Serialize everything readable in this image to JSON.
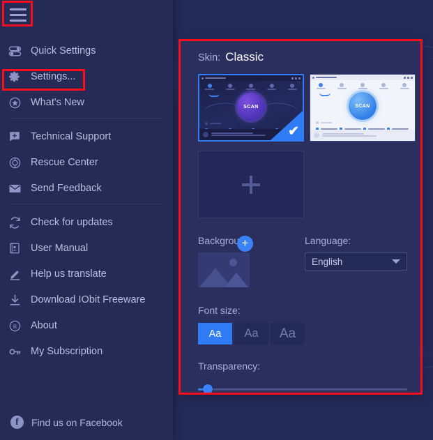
{
  "sidebar": {
    "hamburger_icon": "hamburger-menu-icon",
    "groups": [
      {
        "items": [
          {
            "label": "Quick Settings",
            "icon": "toggle-sliders-icon"
          },
          {
            "label": "Settings...",
            "icon": "gear-icon"
          },
          {
            "label": "What's New",
            "icon": "star-circle-icon"
          }
        ]
      },
      {
        "items": [
          {
            "label": "Technical Support",
            "icon": "support-chat-icon"
          },
          {
            "label": "Rescue Center",
            "icon": "lifebuoy-icon"
          },
          {
            "label": "Send Feedback",
            "icon": "envelope-icon"
          }
        ]
      },
      {
        "items": [
          {
            "label": "Check for updates",
            "icon": "refresh-icon"
          },
          {
            "label": "User Manual",
            "icon": "manual-book-icon"
          },
          {
            "label": "Help us translate",
            "icon": "pencil-icon"
          },
          {
            "label": "Download IObit Freeware",
            "icon": "download-icon"
          },
          {
            "label": "About",
            "icon": "registered-icon"
          },
          {
            "label": "My Subscription",
            "icon": "key-icon"
          }
        ]
      }
    ],
    "footer": {
      "label": "Find us on Facebook",
      "icon": "facebook-icon",
      "glyph": "f"
    }
  },
  "settings": {
    "skin": {
      "label": "Skin:",
      "value": "Classic",
      "thumbnails": [
        {
          "name": "dark-classic-skin",
          "selected": true,
          "scan_label": "SCAN"
        },
        {
          "name": "light-classic-skin",
          "selected": false,
          "scan_label": "SCAN"
        }
      ],
      "add_tile_icon": "plus-icon",
      "selected_check_glyph": "✔"
    },
    "background": {
      "label": "Background:",
      "add_glyph": "+",
      "thumb_icon": "image-placeholder-icon"
    },
    "language": {
      "label": "Language:",
      "value": "English",
      "caret_icon": "chevron-down-icon"
    },
    "font_size": {
      "label": "Font size:",
      "options": [
        {
          "label": "Aa",
          "selected": true
        },
        {
          "label": "Aa",
          "selected": false
        },
        {
          "label": "Aa",
          "selected": false
        }
      ]
    },
    "transparency": {
      "label": "Transparency:",
      "value": 0
    }
  },
  "watermark": {
    "scan_text": "SCAN"
  },
  "colors": {
    "accent_blue": "#2f7cf6",
    "panel_bg": "#2a2f5e",
    "sidebar_bg": "#262b56",
    "app_bg": "#242a58",
    "annotation_red": "#fc0d1b",
    "text_primary": "#b9bedf",
    "text_heading": "#ffffff"
  }
}
